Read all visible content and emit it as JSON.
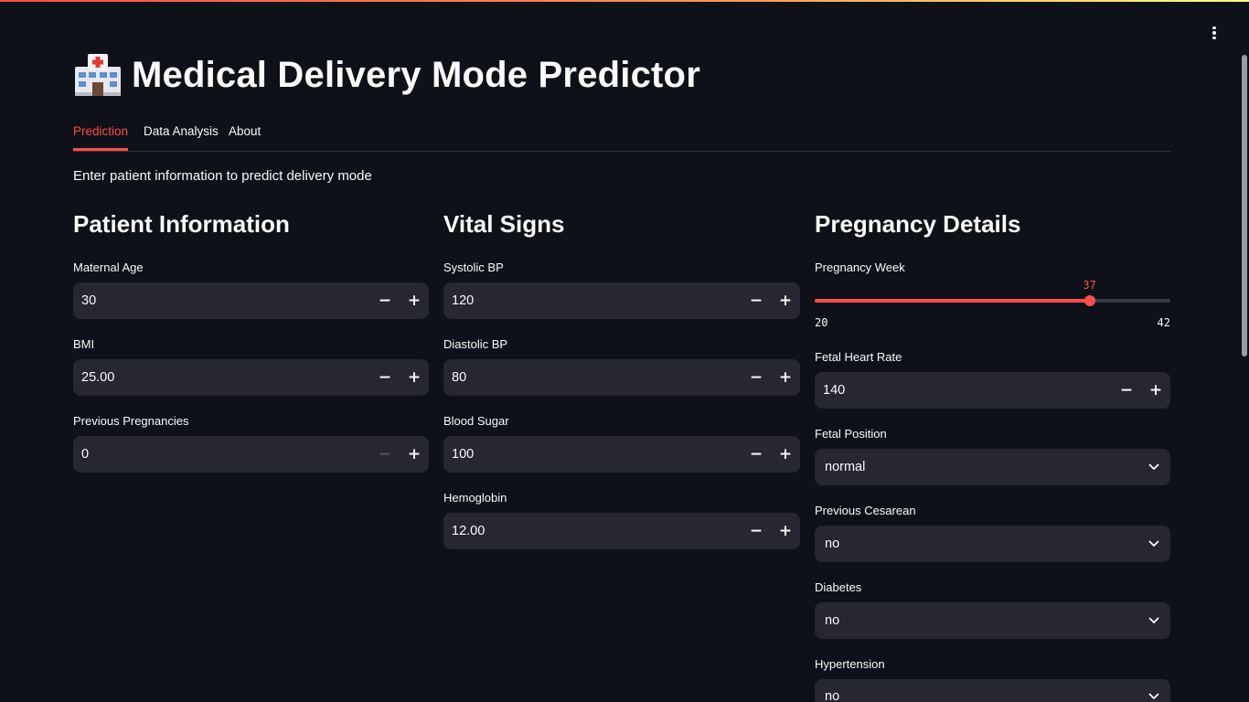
{
  "app": {
    "title_icon": "hospital-icon",
    "title": "Medical Delivery Mode Predictor",
    "colors": {
      "background": "#0e1117",
      "accent": "#ff4b4b",
      "input_bg": "#262730",
      "divider": "#31333f"
    }
  },
  "tabs": [
    {
      "label": "Prediction",
      "active": true
    },
    {
      "label": "Data Analysis",
      "active": false
    },
    {
      "label": "About",
      "active": false
    }
  ],
  "intro": "Enter patient information to predict delivery mode",
  "patient": {
    "heading": "Patient Information",
    "maternal_age": {
      "label": "Maternal Age",
      "value": "30"
    },
    "bmi": {
      "label": "BMI",
      "value": "25.00"
    },
    "previous_pregnancies": {
      "label": "Previous Pregnancies",
      "value": "0"
    }
  },
  "vitals": {
    "heading": "Vital Signs",
    "systolic": {
      "label": "Systolic BP",
      "value": "120"
    },
    "diastolic": {
      "label": "Diastolic BP",
      "value": "80"
    },
    "blood_sugar": {
      "label": "Blood Sugar",
      "value": "100"
    },
    "hemoglobin": {
      "label": "Hemoglobin",
      "value": "12.00"
    }
  },
  "pregnancy": {
    "heading": "Pregnancy Details",
    "week": {
      "label": "Pregnancy Week",
      "value": 37,
      "value_text": "37",
      "min": 20,
      "min_text": "20",
      "max": 42,
      "max_text": "42"
    },
    "fetal_heart_rate": {
      "label": "Fetal Heart Rate",
      "value": "140"
    },
    "fetal_position": {
      "label": "Fetal Position",
      "value": "normal"
    },
    "previous_cesarean": {
      "label": "Previous Cesarean",
      "value": "no"
    },
    "diabetes": {
      "label": "Diabetes",
      "value": "no"
    },
    "hypertension": {
      "label": "Hypertension",
      "value": "no"
    }
  },
  "icons": {
    "minus": "−",
    "plus": "+",
    "menu": "kebab-menu-icon",
    "select_chevron": "chevron-down-icon"
  }
}
